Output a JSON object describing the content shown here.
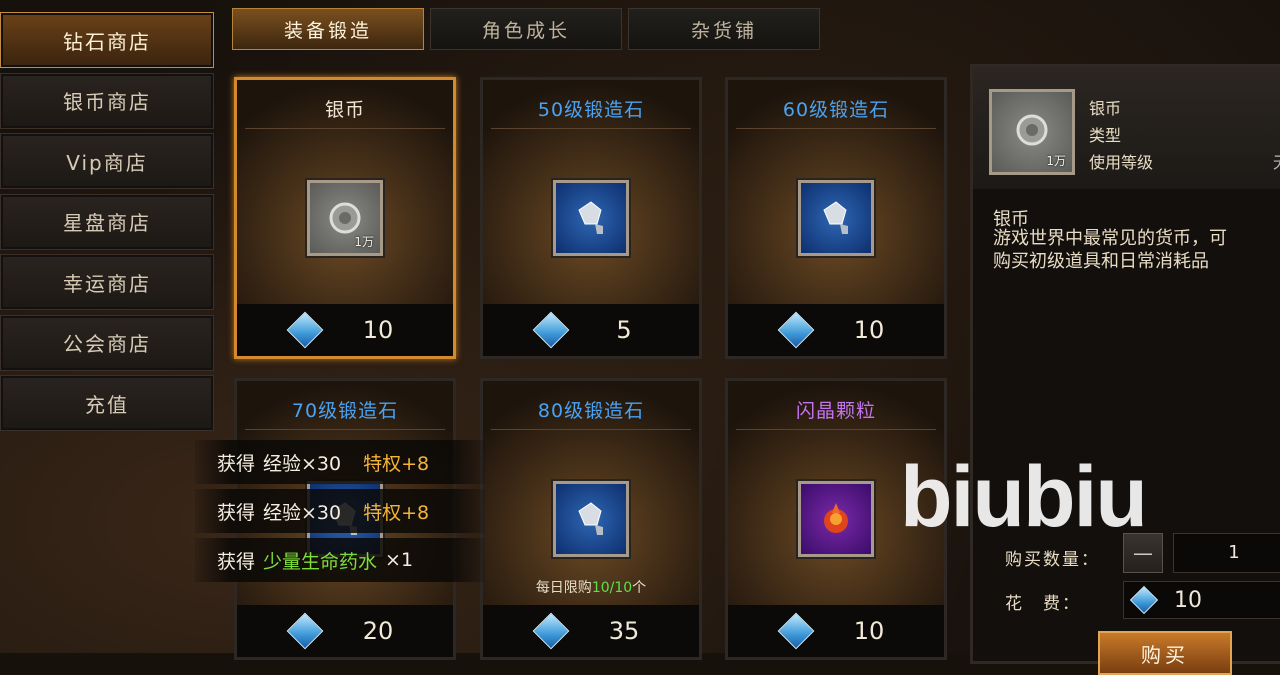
{
  "sidebar": {
    "items": [
      {
        "label": "钻石商店",
        "active": true
      },
      {
        "label": "银币商店"
      },
      {
        "label": "Vip商店"
      },
      {
        "label": "星盘商店"
      },
      {
        "label": "幸运商店"
      },
      {
        "label": "公会商店"
      },
      {
        "label": "充值"
      }
    ]
  },
  "tabs": [
    {
      "label": "装备锻造",
      "active": true
    },
    {
      "label": "角色成长"
    },
    {
      "label": "杂货铺"
    }
  ],
  "items": [
    {
      "name": "银币",
      "name_color": "#efe6d4",
      "icon": "silver-coin-icon",
      "qty": "1万",
      "price": "10",
      "selected": true
    },
    {
      "name": "50级锻造石",
      "name_color": "#4aa2f2",
      "icon": "forge-stone-icon",
      "price": "5"
    },
    {
      "name": "60级锻造石",
      "name_color": "#4aa2f2",
      "icon": "forge-stone-icon",
      "price": "10"
    },
    {
      "name": "70级锻造石",
      "name_color": "#4aa2f2",
      "icon": "forge-stone-icon",
      "price": "20"
    },
    {
      "name": "80级锻造石",
      "name_color": "#4aa2f2",
      "icon": "forge-stone-icon",
      "price": "35",
      "limit_prefix": "每日限购",
      "limit_value": "10/10",
      "limit_suffix": "个"
    },
    {
      "name": "闪晶颗粒",
      "name_color": "#c274f0",
      "icon": "flash-crystal-icon",
      "price": "10"
    }
  ],
  "detail": {
    "name": "银币",
    "type_label": "类型",
    "level_label": "使用等级",
    "level_value": "无",
    "qty": "1万",
    "desc_title": "银币",
    "desc_line1": "游戏世界中最常见的货币，可",
    "desc_line2": "购买初级道具和日常消耗品",
    "buy_qty_label": "购买数量：",
    "minus": "—",
    "quantity": "1",
    "cost_label": "花　费：",
    "cost": "10",
    "buy_button": "购买"
  },
  "rewards": [
    {
      "prefix": "获得",
      "main": "经验×30",
      "extra": "特权+8"
    },
    {
      "prefix": "获得",
      "main": "经验×30",
      "extra": "特权+8"
    },
    {
      "prefix": "获得",
      "main": "少量生命药水",
      "suffix": "×1"
    }
  ],
  "watermark": "biubiu"
}
